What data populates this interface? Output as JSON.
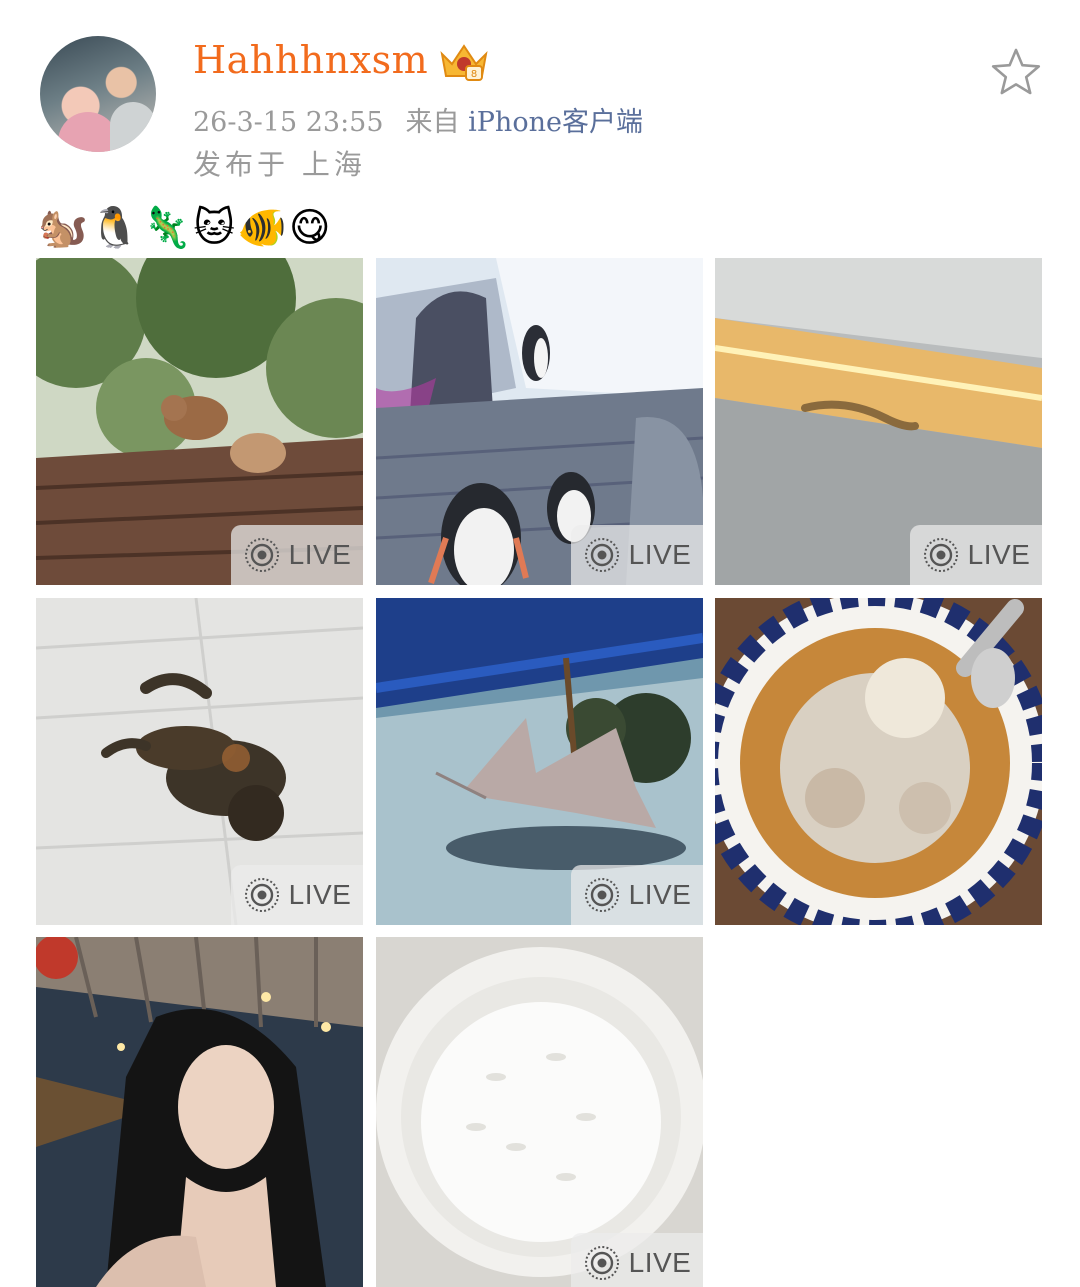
{
  "post": {
    "username": "Hahhhnxsm",
    "timestamp": "26-3-15 23:55",
    "source_prefix": "来自",
    "client": "iPhone客户端",
    "location": "发布于 上海",
    "text_emojis": "🐿️🐧🦎🐱🐠😋"
  },
  "icons": {
    "vip": "crown-vip-icon",
    "favorite": "star-outline-icon",
    "live": "live-photo-icon"
  },
  "colors": {
    "username": "#f26b1d",
    "client_link": "#5a6f9b",
    "meta_gray": "#9a9a9a"
  },
  "images": [
    {
      "subject": "squirrel",
      "live_label": "LIVE"
    },
    {
      "subject": "penguins",
      "live_label": "LIVE"
    },
    {
      "subject": "gecko",
      "live_label": "LIVE"
    },
    {
      "subject": "cat",
      "live_label": "LIVE"
    },
    {
      "subject": "stingray",
      "live_label": "LIVE"
    },
    {
      "subject": "food-plate",
      "live_label": ""
    },
    {
      "subject": "selfie",
      "live_label": ""
    },
    {
      "subject": "rice-bowl",
      "live_label": "LIVE"
    }
  ]
}
